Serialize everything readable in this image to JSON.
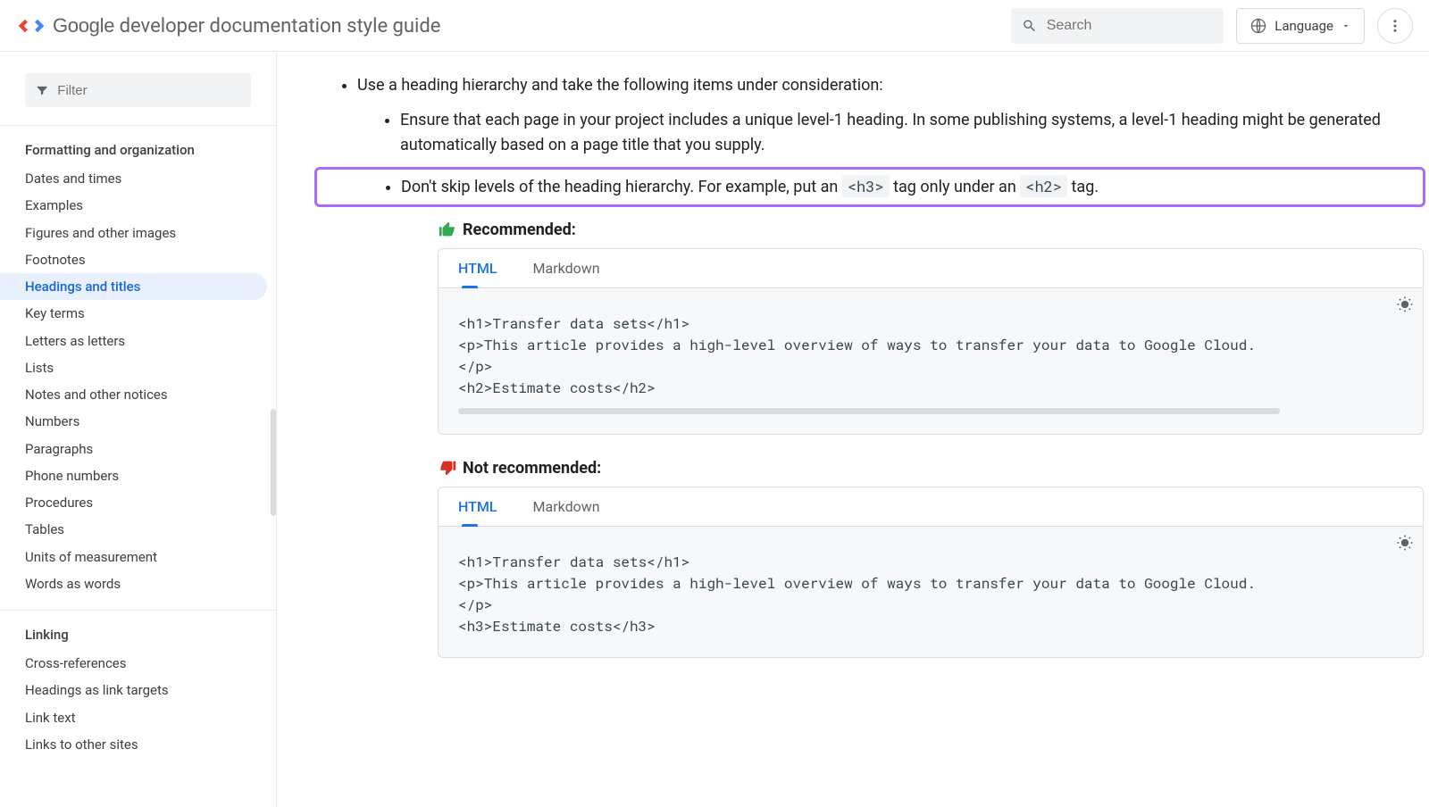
{
  "header": {
    "brand_strong": "Google",
    "brand_rest": " developer documentation style guide",
    "search_placeholder": "Search",
    "language_label": "Language"
  },
  "sidebar": {
    "filter_placeholder": "Filter",
    "sections": [
      {
        "title": "Formatting and organization",
        "items": [
          "Dates and times",
          "Examples",
          "Figures and other images",
          "Footnotes",
          "Headings and titles",
          "Key terms",
          "Letters as letters",
          "Lists",
          "Notes and other notices",
          "Numbers",
          "Paragraphs",
          "Phone numbers",
          "Procedures",
          "Tables",
          "Units of measurement",
          "Words as words"
        ],
        "active_item": "Headings and titles"
      },
      {
        "title": "Linking",
        "items": [
          "Cross-references",
          "Headings as link targets",
          "Link text",
          "Links to other sites"
        ]
      }
    ]
  },
  "content": {
    "top_bullet": "Use a heading hierarchy and take the following items under consideration:",
    "sub_bullet_1": "Ensure that each page in your project includes a unique level-1 heading. In some publishing systems, a level-1 heading might be generated automatically based on a page title that you supply.",
    "hl_pre": "Don't skip levels of the heading hierarchy. For example, put an ",
    "hl_code1": "<h3>",
    "hl_mid": " tag only under an ",
    "hl_code2": "<h2>",
    "hl_post": " tag.",
    "rec_label": "Recommended:",
    "notrec_label": "Not recommended:",
    "tabs": {
      "html": "HTML",
      "markdown": "Markdown"
    },
    "code_rec": "<h1>Transfer data sets</h1>\n<p>This article provides a high-level overview of ways to transfer your data to Google Cloud.\n</p>\n<h2>Estimate costs</h2>",
    "code_notrec": "<h1>Transfer data sets</h1>\n<p>This article provides a high-level overview of ways to transfer your data to Google Cloud.\n</p>\n<h3>Estimate costs</h3>"
  }
}
